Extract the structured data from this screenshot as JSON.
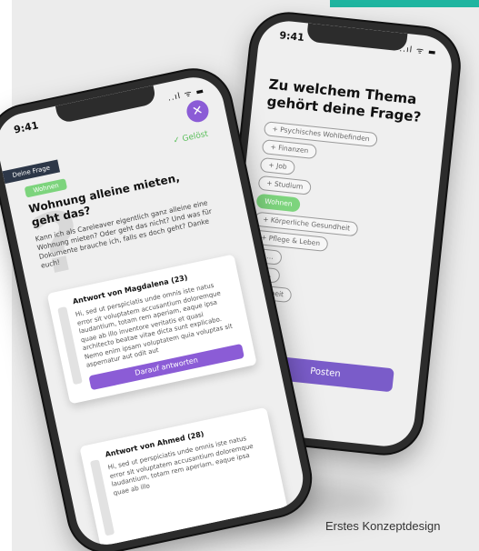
{
  "colors": {
    "teal": "#1fb5a0",
    "purple": "#8b5cd6",
    "green": "#7dd47d"
  },
  "caption": "Erstes Konzeptdesign",
  "back_phone": {
    "time": "9:41",
    "status": "..ıl ᯤ ▬",
    "title": "Zu welchem Thema gehört deine Frage?",
    "topics": [
      {
        "label": "+ Psychisches Wohlbefinden",
        "active": false
      },
      {
        "label": "+ Finanzen",
        "active": false
      },
      {
        "label": "+ Job",
        "active": false
      },
      {
        "label": "+ Studium",
        "active": false
      },
      {
        "label": "Wohnen",
        "active": true
      },
      {
        "label": "+ Körperliche Gesundheit",
        "active": false
      },
      {
        "label": "+ Pflege & Leben",
        "active": false
      },
      {
        "label": "+ ...",
        "active": false
      },
      {
        "label": "+ ...",
        "active": false
      },
      {
        "label": "+ Arbeit",
        "active": false
      }
    ],
    "post_button": "Posten"
  },
  "front_phone": {
    "time": "9:41",
    "status": "..ıl ᯤ ▬",
    "close": "✕",
    "category": "Deine Frage",
    "solved": "✓ Gelöst",
    "tag": "Wohnen",
    "question_title": "Wohnung alleine mieten, geht das?",
    "question_body": "Kann ich als Careleaver eigentlich ganz alleine eine Wohnung mieten? Oder geht das nicht? Und was für Dokumente brauche ich, falls es doch geht? Danke euch!",
    "answers": [
      {
        "author": "Antwort von Magdalena (23)",
        "text": "Hi, sed ut perspiciatis unde omnis iste natus error sit voluptatem accusantium doloremque laudantium, totam rem aperiam, eaque ipsa quae ab illo inventore veritatis et quasi architecto beatae vitae dicta sunt explicabo. Nemo enim ipsam voluptatem quia voluptas sit aspernatur aut odit aut",
        "button": "Darauf antworten"
      },
      {
        "author": "Antwort von Ahmed (28)",
        "text": "Hi, sed ut perspiciatis unde omnis iste natus error sit voluptatem accusantium doloremque laudantium, totam rem aperiam, eaque ipsa quae ab illo"
      }
    ]
  }
}
